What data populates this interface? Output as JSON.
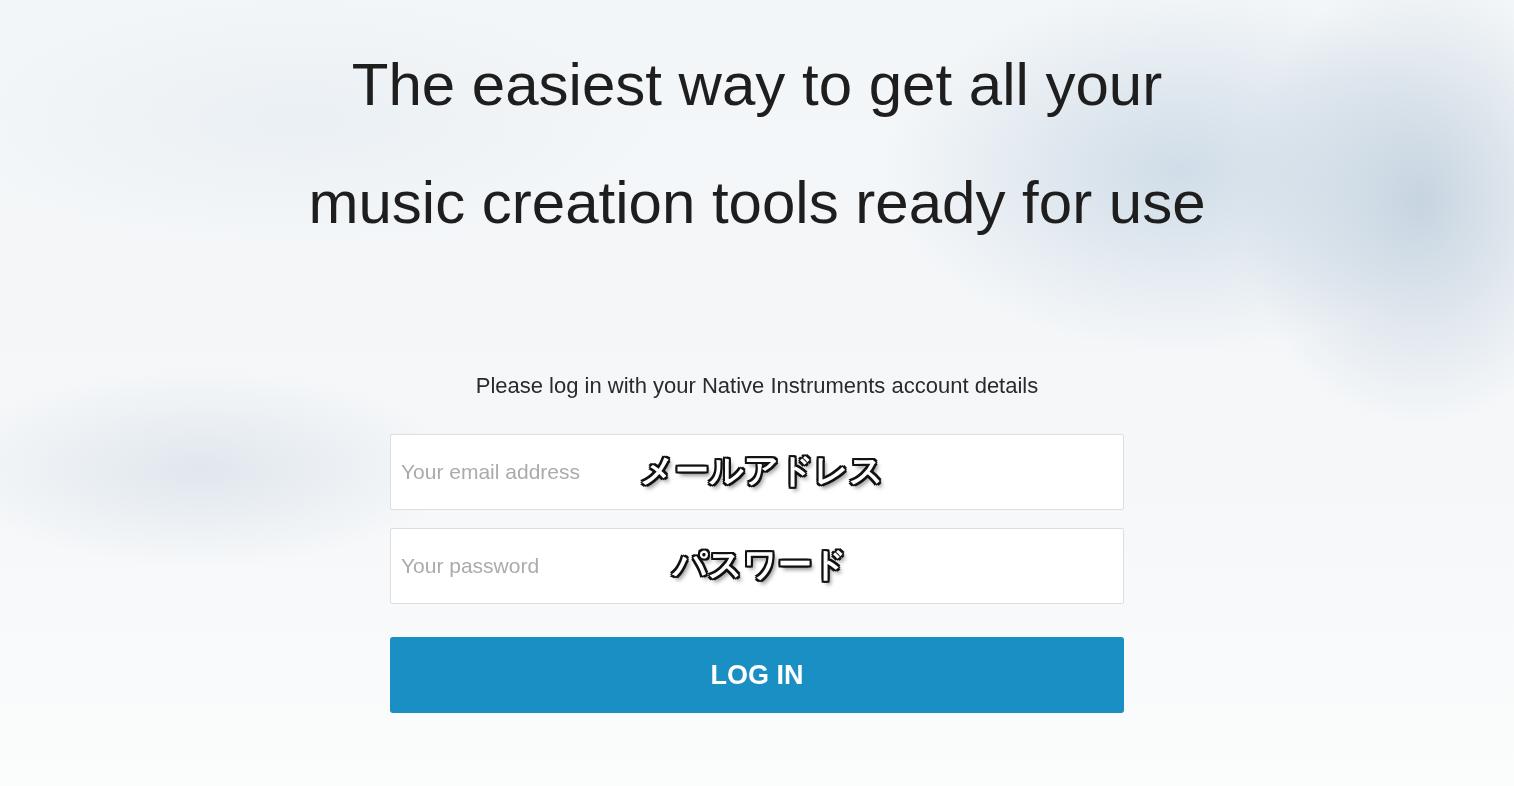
{
  "headline": [
    "The easiest way to get all your",
    "music creation tools ready for use"
  ],
  "login_form": {
    "prompt": "Please log in with your Native Instruments account details",
    "fields": [
      {
        "placeholder": "Your email address",
        "annotation": "メールアドレス"
      },
      {
        "placeholder": "Your password",
        "annotation": "パスワード"
      }
    ],
    "button": "LOG IN"
  }
}
